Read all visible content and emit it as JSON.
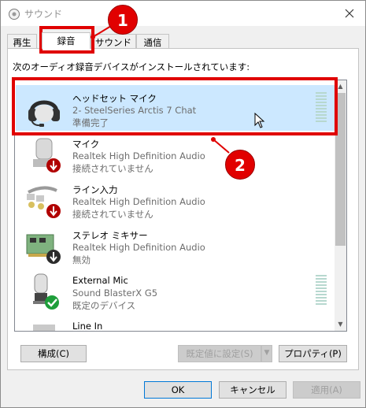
{
  "window": {
    "title": "サウンド",
    "close_glyph": "✕"
  },
  "tabs": [
    {
      "label": "再生"
    },
    {
      "label": "録音"
    },
    {
      "label": "サウンド"
    },
    {
      "label": "通信"
    }
  ],
  "instruction": "次のオーディオ録音デバイスがインストールされています:",
  "devices": [
    {
      "name": "ヘッドセット マイク",
      "driver": "2- SteelSeries Arctis 7 Chat",
      "status": "準備完了",
      "icon": "headset-icon",
      "selected": true
    },
    {
      "name": "マイク",
      "driver": "Realtek High Definition Audio",
      "status": "接続されていません",
      "icon": "microphone-icon",
      "badge": "unplugged"
    },
    {
      "name": "ライン入力",
      "driver": "Realtek High Definition Audio",
      "status": "接続されていません",
      "icon": "line-in-cable-icon",
      "badge": "unplugged"
    },
    {
      "name": "ステレオ ミキサー",
      "driver": "Realtek High Definition Audio",
      "status": "無効",
      "icon": "sound-card-icon",
      "badge": "disabled"
    },
    {
      "name": "External Mic",
      "driver": "Sound BlasterX G5",
      "status": "既定のデバイス",
      "icon": "external-mic-icon",
      "badge": "default"
    },
    {
      "name": "Line In",
      "driver": "",
      "status": "",
      "icon": "line-in-icon"
    }
  ],
  "buttons": {
    "configure": "構成(C)",
    "set_default": "既定値に設定(S)",
    "properties": "プロパティ(P)",
    "ok": "OK",
    "cancel": "キャンセル",
    "apply": "適用(A)"
  },
  "annotations": {
    "badge1": "1",
    "badge2": "2"
  },
  "colors": {
    "annotation_red": "#e00000",
    "selection": "#cce8ff"
  }
}
